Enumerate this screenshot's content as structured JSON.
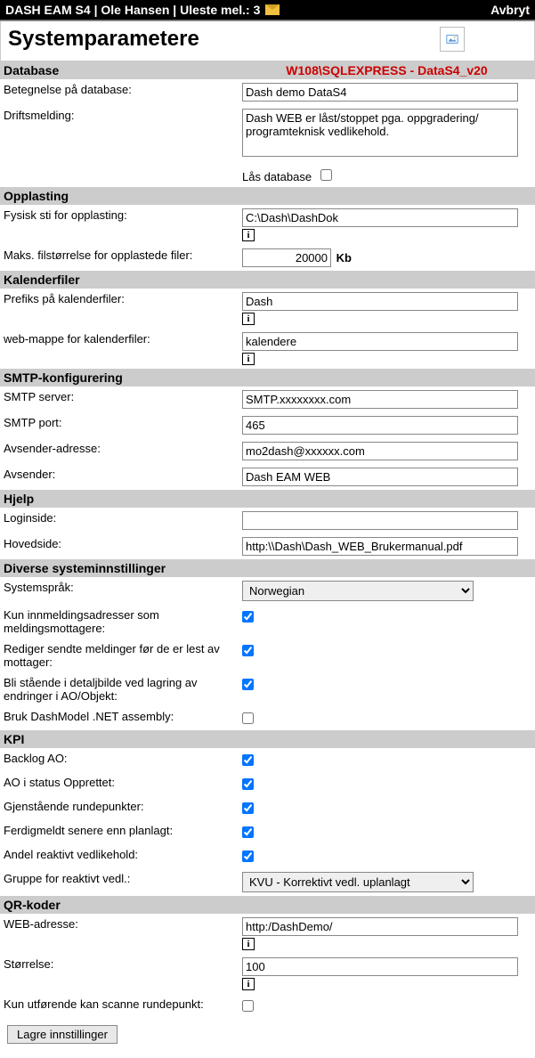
{
  "topbar": {
    "text": "DASH EAM S4 | Ole Hansen | Uleste mel.: 3",
    "avbryt": "Avbryt"
  },
  "page_title": "Systemparametere",
  "sections": {
    "database": {
      "header": "Database",
      "server": "W108\\SQLEXPRESS - DataS4_v20",
      "betegnelse_label": "Betegnelse på database:",
      "betegnelse_value": "Dash demo DataS4",
      "driftsmelding_label": "Driftsmelding:",
      "driftsmelding_value": "Dash WEB er låst/stoppet pga. oppgradering/ programteknisk vedlikehold.",
      "lock_label": "Lås database"
    },
    "opplasting": {
      "header": "Opplasting",
      "sti_label": "Fysisk sti for opplasting:",
      "sti_value": "C:\\Dash\\DashDok",
      "maks_label": "Maks. filstørrelse for opplastede filer:",
      "maks_value": "20000",
      "maks_unit": "Kb"
    },
    "kalender": {
      "header": "Kalenderfiler",
      "prefiks_label": "Prefiks på kalenderfiler:",
      "prefiks_value": "Dash",
      "mappe_label": "web-mappe for kalenderfiler:",
      "mappe_value": "kalendere"
    },
    "smtp": {
      "header": "SMTP-konfigurering",
      "server_label": "SMTP server:",
      "server_value": "SMTP.xxxxxxxx.com",
      "port_label": "SMTP port:",
      "port_value": "465",
      "from_addr_label": "Avsender-adresse:",
      "from_addr_value": "mo2dash@xxxxxx.com",
      "from_name_label": "Avsender:",
      "from_name_value": "Dash EAM WEB"
    },
    "hjelp": {
      "header": "Hjelp",
      "login_label": "Loginside:",
      "login_value": "",
      "hoved_label": "Hovedside:",
      "hoved_value": "http:\\\\Dash\\Dash_WEB_Brukermanual.pdf"
    },
    "diverse": {
      "header": "Diverse systeminnstillinger",
      "sprak_label": "Systemspråk:",
      "sprak_value": "Norwegian",
      "kun_innmeld_label": "Kun innmeldingsadresser som meldingsmottagere:",
      "rediger_label": "Rediger sendte meldinger før de er lest av mottager:",
      "bli_staende_label": "Bli stående i detaljbilde ved lagring av endringer i AO/Objekt:",
      "bruk_dashmodel_label": "Bruk DashModel .NET assembly:"
    },
    "kpi": {
      "header": "KPI",
      "backlog_label": "Backlog AO:",
      "ao_status_label": "AO i status Opprettet:",
      "gjenstaende_label": "Gjenstående rundepunkter:",
      "ferdigmeldt_label": "Ferdigmeldt senere enn planlagt:",
      "andel_label": "Andel reaktivt vedlikehold:",
      "gruppe_label": "Gruppe for reaktivt vedl.:",
      "gruppe_value": "KVU - Korrektivt vedl. uplanlagt"
    },
    "qr": {
      "header": "QR-koder",
      "web_label": "WEB-adresse:",
      "web_value": "http:/DashDemo/",
      "storrelse_label": "Størrelse:",
      "storrelse_value": "100",
      "kun_utforende_label": "Kun utførende kan scanne rundepunkt:"
    }
  },
  "submit_label": "Lagre innstillinger",
  "info_char": "i"
}
